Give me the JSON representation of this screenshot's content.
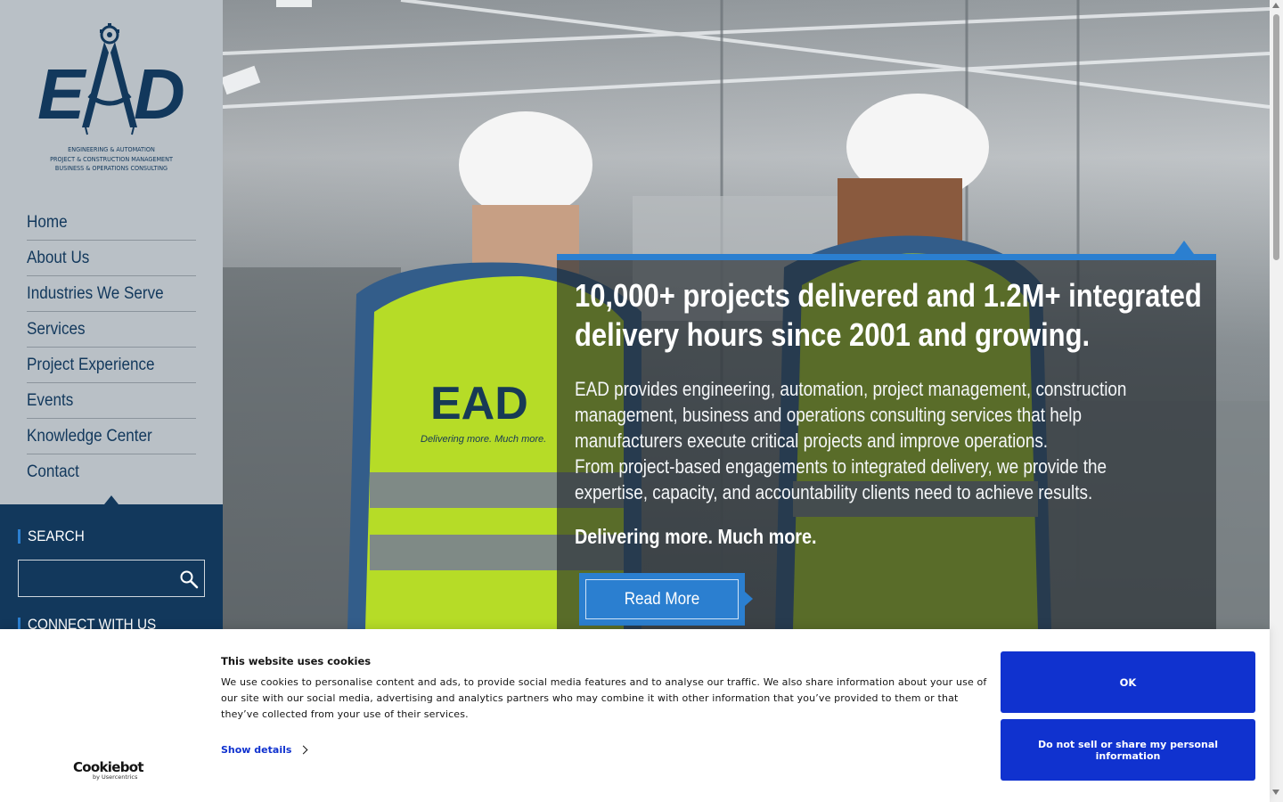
{
  "logo": {
    "letters": "EAD",
    "tagline": [
      "ENGINEERING & AUTOMATION",
      "PROJECT & CONSTRUCTION MANAGEMENT",
      "BUSINESS & OPERATIONS CONSULTING"
    ]
  },
  "nav": {
    "items": [
      {
        "label": "Home"
      },
      {
        "label": "About Us"
      },
      {
        "label": "Industries We Serve"
      },
      {
        "label": "Services"
      },
      {
        "label": "Project Experience"
      },
      {
        "label": "Events"
      },
      {
        "label": "Knowledge Center"
      },
      {
        "label": "Contact"
      }
    ]
  },
  "search": {
    "heading": "SEARCH",
    "placeholder": "",
    "icon": "search-icon"
  },
  "connect": {
    "heading": "CONNECT WITH US"
  },
  "hero": {
    "headline": [
      "10,000+ projects delivered and 1.2M+ integrated",
      "delivery hours since 2001 and growing."
    ],
    "body": [
      "EAD provides engineering, automation, project management, construction",
      "management, business and operations consulting services that help",
      "manufacturers execute critical projects and improve operations.",
      "From project-based engagements to integrated delivery, we provide the",
      "expertise, capacity, and accountability clients need to achieve results."
    ],
    "tagline": "Delivering more. Much more.",
    "cta_label": "Read More",
    "vest_logo": "EAD",
    "vest_slogan": "Delivering more. Much more."
  },
  "cookie_banner": {
    "title": "This website uses cookies",
    "text": "We use cookies to personalise content and ads, to provide social media features and to analyse our traffic. We also share information about your use of our site with our social media, advertising and analytics partners who may combine it with other information that you’ve provided to them or that they’ve collected from your use of their services.",
    "show_details": "Show details",
    "ok_label": "OK",
    "dns_label": "Do not sell or share my personal information",
    "brand": "Cookiebot",
    "brand_sub": "by Usercentrics"
  },
  "colors": {
    "brand_navy": "#12385c",
    "accent_blue": "#2b7fd0",
    "cookie_blue": "#1032cf",
    "sidebar_gray": "#b9c0c6"
  }
}
